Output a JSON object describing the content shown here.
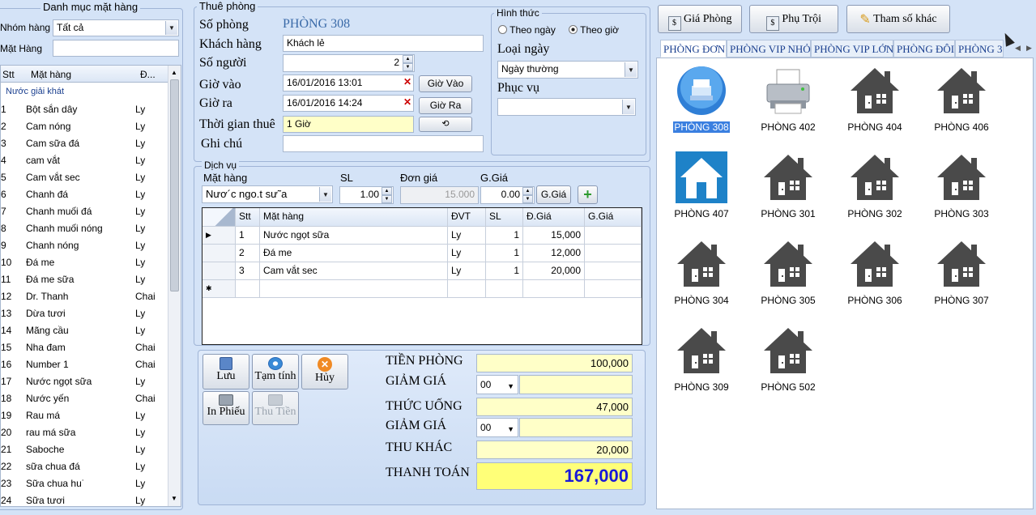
{
  "left": {
    "group_title": "Danh mục mặt hàng",
    "nhom_hang_label": "Nhóm hàng",
    "nhom_hang_value": "Tất cả",
    "mat_hang_label": "Mặt Hàng",
    "mat_hang_value": "",
    "col_stt": "Stt",
    "col_mathang": "Mặt hàng",
    "col_dvt": "Đ...",
    "category": "Nước giải khát",
    "items": [
      {
        "stt": "1",
        "name": "Bột sắn dây",
        "dvt": "Ly"
      },
      {
        "stt": "2",
        "name": "Cam nóng",
        "dvt": "Ly"
      },
      {
        "stt": "3",
        "name": "Cam sữa đá",
        "dvt": "Ly"
      },
      {
        "stt": "4",
        "name": "cam vắt",
        "dvt": "Ly"
      },
      {
        "stt": "5",
        "name": "Cam vắt sec",
        "dvt": "Ly"
      },
      {
        "stt": "6",
        "name": "Chanh đá",
        "dvt": "Ly"
      },
      {
        "stt": "7",
        "name": "Chanh muối  đá",
        "dvt": "Ly"
      },
      {
        "stt": "8",
        "name": "Chanh muối nóng",
        "dvt": "Ly"
      },
      {
        "stt": "9",
        "name": "Chanh nóng",
        "dvt": "Ly"
      },
      {
        "stt": "10",
        "name": "Đá me",
        "dvt": "Ly"
      },
      {
        "stt": "11",
        "name": "Đá me sữa",
        "dvt": "Ly"
      },
      {
        "stt": "12",
        "name": "Dr. Thanh",
        "dvt": "Chai"
      },
      {
        "stt": "13",
        "name": "Dừa tươi",
        "dvt": "Ly"
      },
      {
        "stt": "14",
        "name": "Mãng cầu",
        "dvt": "Ly"
      },
      {
        "stt": "15",
        "name": "Nha đam",
        "dvt": "Chai"
      },
      {
        "stt": "16",
        "name": "Number 1",
        "dvt": "Chai"
      },
      {
        "stt": "17",
        "name": "Nước ngọt sữa",
        "dvt": "Ly"
      },
      {
        "stt": "18",
        "name": "Nước yến",
        "dvt": "Chai"
      },
      {
        "stt": "19",
        "name": "Rau má",
        "dvt": "Ly"
      },
      {
        "stt": "20",
        "name": "rau má sữa",
        "dvt": "Ly"
      },
      {
        "stt": "21",
        "name": "Saboche",
        "dvt": "Ly"
      },
      {
        "stt": "22",
        "name": "sữa chua đá",
        "dvt": "Ly"
      },
      {
        "stt": "23",
        "name": "Sữa chua hu˙",
        "dvt": "Ly"
      },
      {
        "stt": "24",
        "name": "Sữa tươi",
        "dvt": "Ly"
      }
    ]
  },
  "thue": {
    "group_title": "Thuê phòng",
    "so_phong_label": "Số phòng",
    "so_phong_value": "PHÒNG 308",
    "khach_hang_label": "Khách hàng",
    "khach_hang_value": "Khách lẻ",
    "so_nguoi_label": "Số người",
    "so_nguoi_value": "2",
    "gio_vao_label": "Giờ vào",
    "gio_vao_value": "16/01/2016 13:01",
    "gio_vao_btn": "Giờ Vào",
    "gio_ra_label": "Giờ ra",
    "gio_ra_value": "16/01/2016 14:24",
    "gio_ra_btn": "Giờ Ra",
    "thoi_gian_label": "Thời gian thuê",
    "thoi_gian_value": "1 Giờ",
    "ghi_chu_label": "Ghi chú",
    "ghi_chu_value": ""
  },
  "hinhthuc": {
    "group_title": "Hình thức",
    "opt1": "Theo ngày",
    "opt2": "Theo giờ",
    "loai_ngay_label": "Loại ngày",
    "loai_ngay_value": "Ngày thường",
    "phuc_vu_label": "Phục vụ",
    "phuc_vu_value": ""
  },
  "dichvu": {
    "group_title": "Dịch vụ",
    "mat_hang_label": "Mặt hàng",
    "sl_label": "SL",
    "don_gia_label": "Đơn giá",
    "g_gia_label": "G.Giá",
    "mat_hang_value": "Nươ´c ngo.t sư˜a",
    "sl_value": "1.00",
    "don_gia_value": "15.000",
    "g_gia_value": "0.00",
    "g_gia_btn": "G.Giá",
    "add_btn": "+",
    "grid_headers": [
      "Stt",
      "Mặt hàng",
      "ĐVT",
      "SL",
      "Đ.Giá",
      "G.Giá"
    ],
    "rows": [
      {
        "stt": "1",
        "name": "Nước ngọt sữa",
        "dvt": "Ly",
        "sl": "1",
        "dg": "15,000",
        "gg": ""
      },
      {
        "stt": "2",
        "name": "Đá me",
        "dvt": "Ly",
        "sl": "1",
        "dg": "12,000",
        "gg": ""
      },
      {
        "stt": "3",
        "name": "Cam vắt sec",
        "dvt": "Ly",
        "sl": "1",
        "dg": "20,000",
        "gg": ""
      }
    ],
    "current_marker": "▶",
    "new_marker": "✱"
  },
  "actions": {
    "luu": "Lưu",
    "tam_tinh": "Tạm tính",
    "huy": "Hủy",
    "in_phieu": "In Phiếu",
    "thu_tien": "Thu Tiền"
  },
  "totals": {
    "tien_phong_label": "TIỀN PHÒNG",
    "tien_phong_value": "100,000",
    "giam_gia1_label": "GIẢM GIÁ",
    "giam_gia1_select": "00",
    "giam_gia1_value": "",
    "thuc_uong_label": "THỨC UỐNG",
    "thuc_uong_value": "47,000",
    "giam_gia2_label": "GIẢM GIÁ",
    "giam_gia2_select": "00",
    "giam_gia2_value": "",
    "thu_khac_label": "THU KHÁC",
    "thu_khac_value": "20,000",
    "thanh_toan_label": "THANH TOÁN",
    "thanh_toan_value": "167,000"
  },
  "toolbar": {
    "gia_phong": "Giá Phòng",
    "phu_troi": "Phụ Trội",
    "tham_so": "Tham số khác"
  },
  "tabs": [
    "PHÒNG ĐƠN",
    "PHÒNG VIP NHỎ",
    "PHÒNG VIP LỚN",
    "PHÒNG ĐÔI",
    "PHÒNG 3"
  ],
  "rooms": [
    {
      "name": "PHÒNG 308",
      "icon": "room-selected-icon",
      "selected": true
    },
    {
      "name": "PHÒNG 402",
      "icon": "printer-icon"
    },
    {
      "name": "PHÒNG 404",
      "icon": "house-icon"
    },
    {
      "name": "PHÒNG 406",
      "icon": "house-icon"
    },
    {
      "name": "PHÒNG 407",
      "icon": "house-blue-icon"
    },
    {
      "name": "PHÒNG 301",
      "icon": "house-icon"
    },
    {
      "name": "PHÒNG 302",
      "icon": "house-icon"
    },
    {
      "name": "PHÒNG 303",
      "icon": "house-icon"
    },
    {
      "name": "PHÒNG 304",
      "icon": "house-icon"
    },
    {
      "name": "PHÒNG 305",
      "icon": "house-icon"
    },
    {
      "name": "PHÒNG 306",
      "icon": "house-icon"
    },
    {
      "name": "PHÒNG 307",
      "icon": "house-icon"
    },
    {
      "name": "PHÒNG 309",
      "icon": "house-icon"
    },
    {
      "name": "PHÒNG 502",
      "icon": "house-icon"
    }
  ],
  "colors": {
    "bg": "#d4e3f7",
    "house": "#4a4a4a",
    "blue_tile": "#1e82c8",
    "yellow_field": "#ffffc8",
    "total_text": "#1a1ad8"
  }
}
